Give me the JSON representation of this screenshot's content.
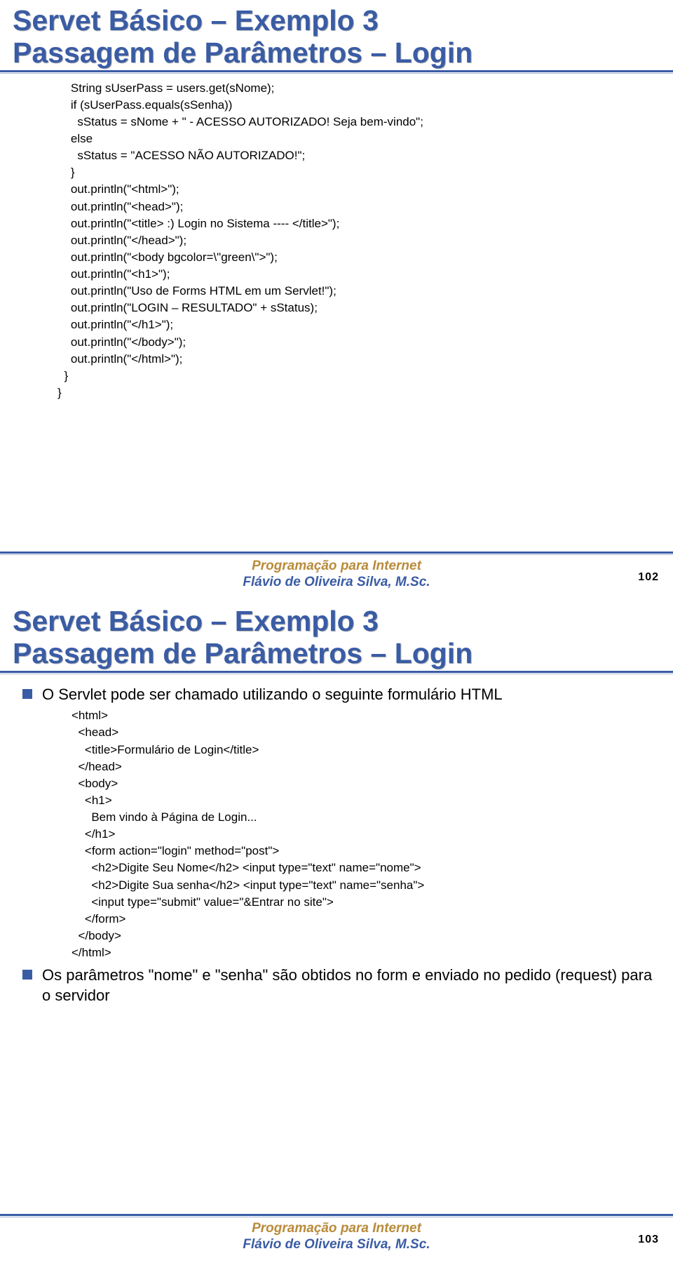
{
  "slide1": {
    "title_line1": "Servet Básico – Exemplo 3",
    "title_line2": "Passagem de Parâmetros – Login",
    "code": "    String sUserPass = users.get(sNome);\n    if (sUserPass.equals(sSenha))\n      sStatus = sNome + \" - ACESSO AUTORIZADO! Seja bem-vindo\";\n    else\n      sStatus = \"ACESSO NÃO AUTORIZADO!\";\n    }\n    out.println(\"<html>\");\n    out.println(\"<head>\");\n    out.println(\"<title> :) Login no Sistema ---- </title>\");\n    out.println(\"</head>\");\n    out.println(\"<body bgcolor=\\\"green\\\">\");\n    out.println(\"<h1>\");\n    out.println(\"Uso de Forms HTML em um Servlet!\");\n    out.println(\"LOGIN – RESULTADO\" + sStatus);\n    out.println(\"</h1>\");\n    out.println(\"</body>\");\n    out.println(\"</html>\");\n  }\n}",
    "page_num": "102"
  },
  "slide2": {
    "title_line1": "Servet Básico – Exemplo 3",
    "title_line2": "Passagem de Parâmetros – Login",
    "bullet1": "O Servlet pode ser chamado utilizando o seguinte formulário HTML",
    "html_code": "<html>\n  <head>\n    <title>Formulário de Login</title>\n  </head>\n  <body>\n    <h1>\n      Bem vindo à Página de Login...\n    </h1>\n    <form action=\"login\" method=\"post\">\n      <h2>Digite Seu Nome</h2> <input type=\"text\" name=\"nome\">\n      <h2>Digite Sua senha</h2> <input type=\"text\" name=\"senha\">\n      <input type=\"submit\" value=\"&Entrar no site\">\n    </form>\n  </body>\n</html>",
    "bullet2": "Os parâmetros \"nome\" e \"senha\" são obtidos no form e enviado no pedido (request) para o servidor",
    "page_num": "103"
  },
  "footer": {
    "line1": "Programação para Internet",
    "line2": "Flávio de Oliveira Silva, M.Sc."
  }
}
